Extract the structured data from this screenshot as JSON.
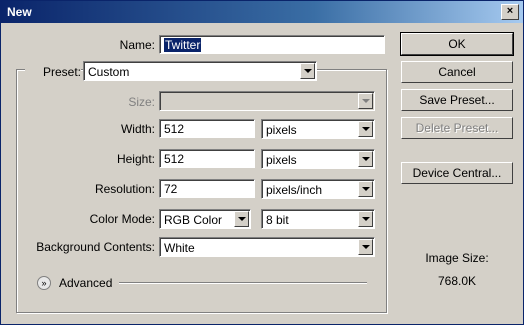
{
  "window": {
    "title": "New",
    "close_glyph": "×"
  },
  "name": {
    "label": "Name:",
    "value": "Twitter"
  },
  "preset": {
    "label": "Preset:",
    "value": "Custom"
  },
  "size": {
    "label": "Size:",
    "value": ""
  },
  "width": {
    "label": "Width:",
    "value": "512",
    "unit": "pixels"
  },
  "height": {
    "label": "Height:",
    "value": "512",
    "unit": "pixels"
  },
  "resolution": {
    "label": "Resolution:",
    "value": "72",
    "unit": "pixels/inch"
  },
  "color_mode": {
    "label": "Color Mode:",
    "value": "RGB Color",
    "depth": "8 bit"
  },
  "background": {
    "label": "Background Contents:",
    "value": "White"
  },
  "advanced": {
    "label": "Advanced",
    "icon_glyph": "»",
    "icon": "expand-chevron-icon"
  },
  "buttons": {
    "ok": "OK",
    "cancel": "Cancel",
    "save_preset": "Save Preset...",
    "delete_preset": "Delete Preset...",
    "device_central": "Device Central..."
  },
  "image_size": {
    "label": "Image Size:",
    "value": "768.0K"
  }
}
